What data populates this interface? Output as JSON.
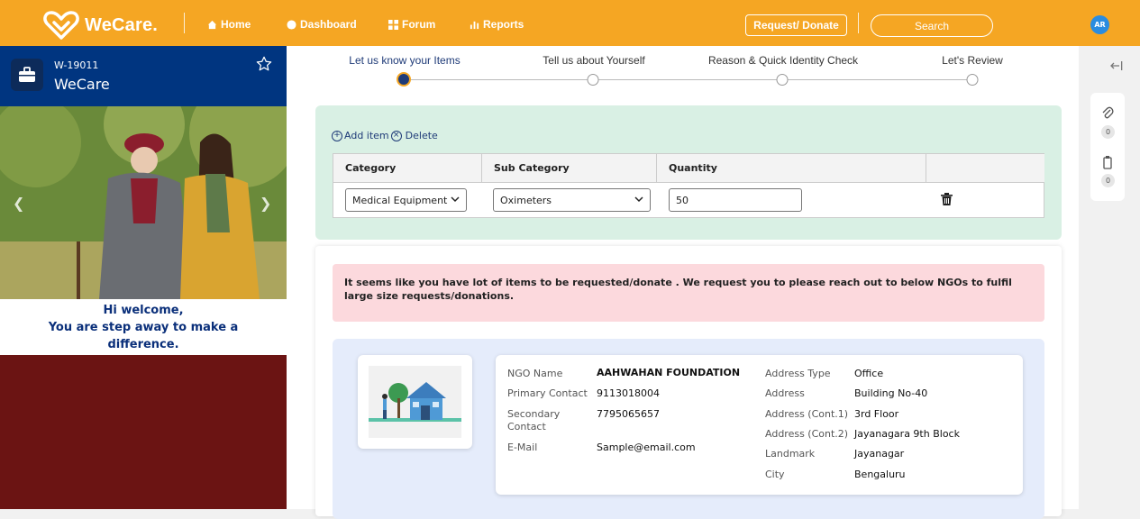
{
  "app": {
    "name": "WeCare."
  },
  "nav": {
    "home": "Home",
    "dashboard": "Dashboard",
    "forum": "Forum",
    "reports": "Reports"
  },
  "header": {
    "request_button": "Request/ Donate",
    "search_placeholder": "Search",
    "avatar_initials": "AR"
  },
  "case": {
    "id": "W-19011",
    "name": "WeCare"
  },
  "welcome": {
    "line1": "Hi welcome,",
    "line2": "You are step away to make a",
    "line3": "difference."
  },
  "steps": [
    {
      "label": "Let us know your Items",
      "active": true
    },
    {
      "label": "Tell us about Yourself",
      "active": false
    },
    {
      "label": "Reason & Quick Identity Check",
      "active": false
    },
    {
      "label": "Let's Review",
      "active": false
    }
  ],
  "items": {
    "add_label": "Add item",
    "delete_label": "Delete",
    "columns": [
      "Category",
      "Sub Category",
      "Quantity",
      ""
    ],
    "rows": [
      {
        "category": "Medical Equipment",
        "sub_category": "Oximeters",
        "quantity": "50"
      }
    ]
  },
  "alert": {
    "message": "It seems like you have lot of items to be requested/donate . We request you to please reach out to below NGOs to fulfil large size requests/donations."
  },
  "ngo": {
    "name_label": "NGO Name",
    "name": "AAHWAHAN FOUNDATION",
    "primary_label": "Primary Contact",
    "primary": "9113018004",
    "secondary_label": "Secondary Contact",
    "secondary": "7795065657",
    "email_label": "E-Mail",
    "email": "Sample@email.com",
    "address_type_label": "Address Type",
    "address_type": "Office",
    "address_label": "Address",
    "address": "Building No-40",
    "address2_label": "Address (Cont.1)",
    "address2": "3rd Floor",
    "address3_label": "Address (Cont.2)",
    "address3": "Jayanagara 9th Block",
    "landmark_label": "Landmark",
    "landmark": "Jayanagar",
    "city_label": "City",
    "city": "Bengaluru"
  },
  "rail": {
    "attachments_count": "0",
    "clipboard_count": "0"
  },
  "colors": {
    "topbar": "#f5a623",
    "navy": "#003580",
    "maroon": "#6b1413",
    "green_panel": "#d9f0e4",
    "alert": "#fcd9dd",
    "ngo_panel": "#e5ecfb"
  }
}
